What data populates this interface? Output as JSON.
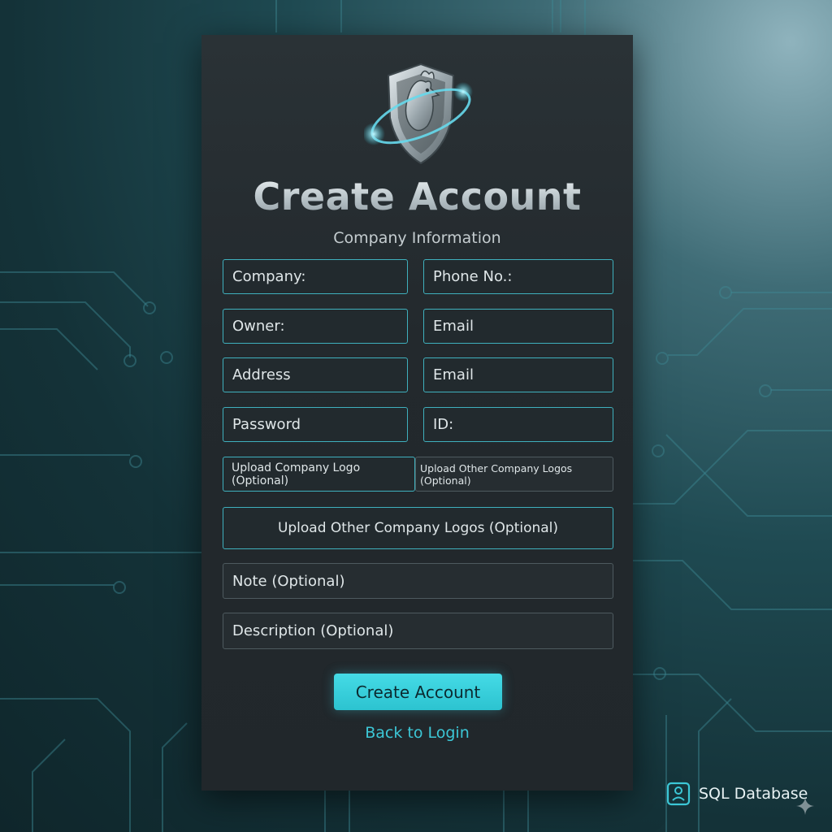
{
  "form": {
    "title": "Create Account",
    "subtitle": "Company Information",
    "fields": {
      "company": "Company:",
      "phone": "Phone No.:",
      "owner": "Owner:",
      "email_1": "Email",
      "address": "Address",
      "email_2": "Email",
      "password": "Password",
      "id": "ID:",
      "upload_logo": "Upload Company Logo (Optional)",
      "upload_other_small": "Upload Other Company Logos (Optional)",
      "upload_other_wide": "Upload Other Company Logos (Optional)",
      "note": "Note (Optional)",
      "description": "Description (Optional)"
    },
    "submit_label": "Create Account",
    "back_link": "Back to Login"
  },
  "footer_badge": {
    "label": "SQL Database",
    "icon": "database-badge-icon"
  },
  "colors": {
    "accent": "#3cc7d6",
    "button": "#2cc3d0",
    "card": "#23292d",
    "field_border": "#3fb0bd"
  }
}
